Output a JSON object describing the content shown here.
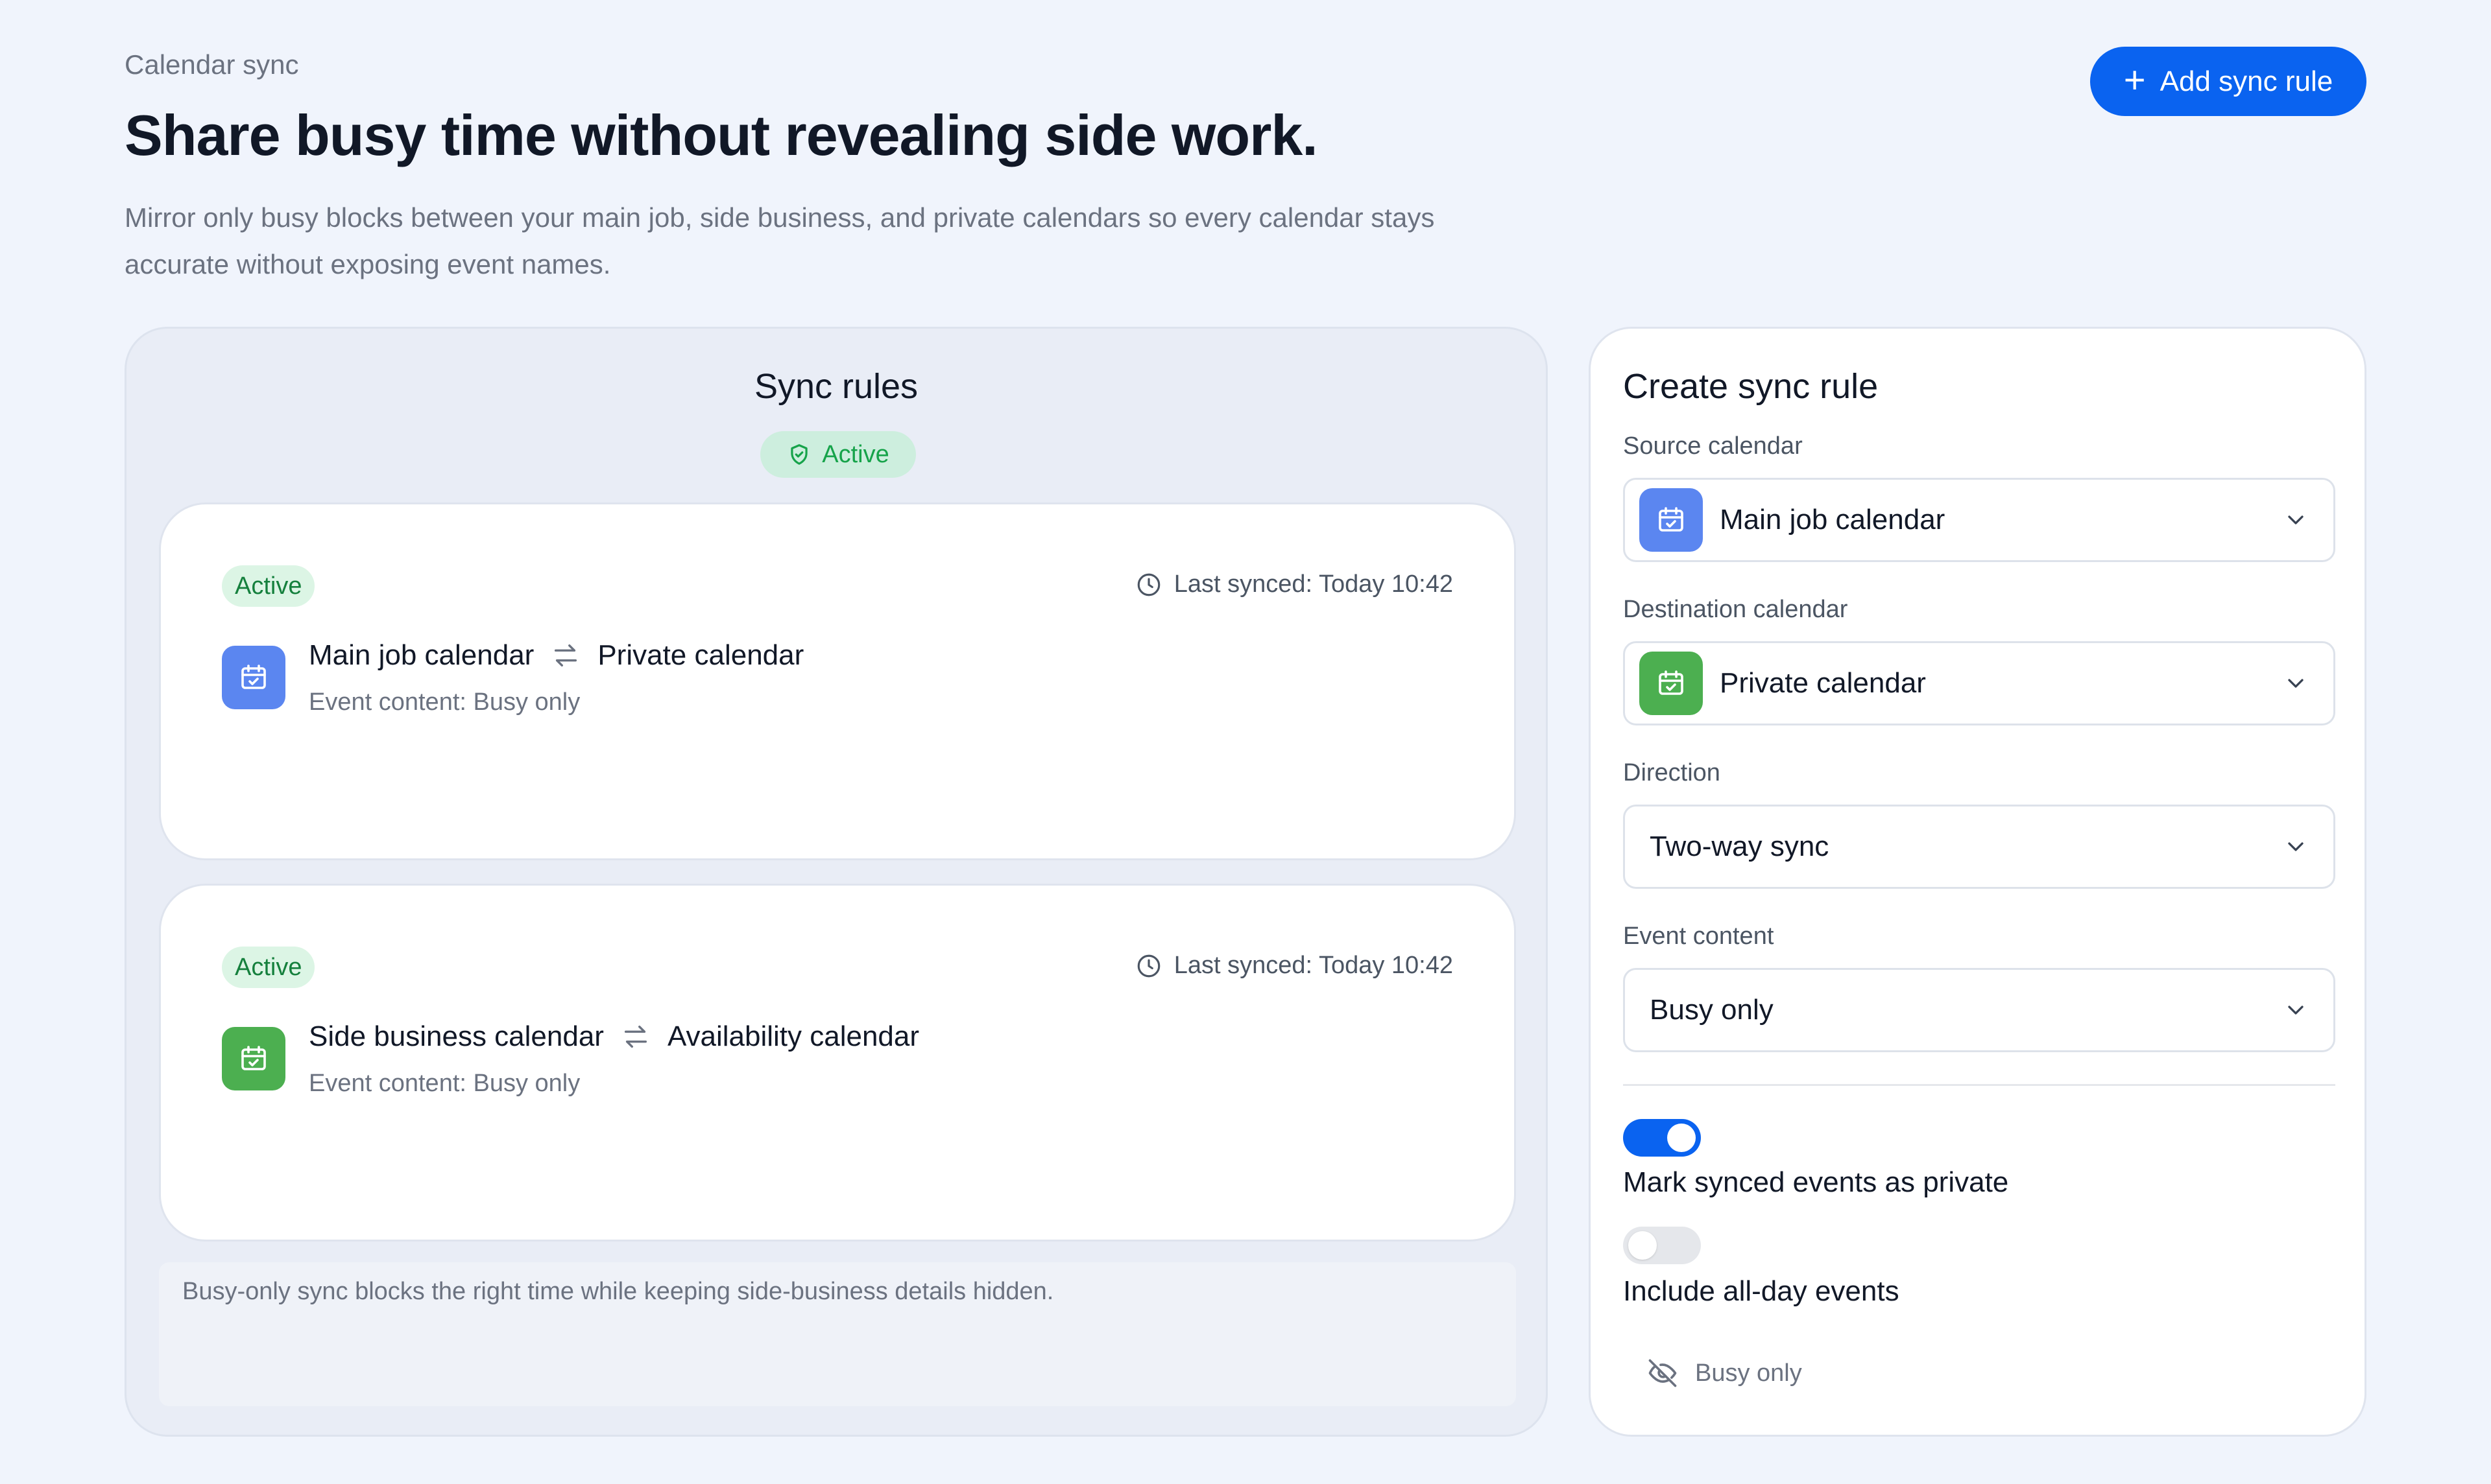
{
  "header": {
    "eyebrow": "Calendar sync",
    "title": "Share busy time without revealing side work.",
    "description": "Mirror only busy blocks between your main job, side business, and private calendars so every calendar stays accurate without exposing event names.",
    "add_button_label": "Add sync rule"
  },
  "rules_panel": {
    "title": "Sync rules",
    "status_badge": "Active",
    "rules": [
      {
        "status": "Active",
        "last_synced": "Last synced: Today 10:42",
        "source": "Main job calendar",
        "destination": "Private calendar",
        "content": "Event content: Busy only",
        "icon_color": "#5b86f0"
      },
      {
        "status": "Active",
        "last_synced": "Last synced: Today 10:42",
        "source": "Side business calendar",
        "destination": "Availability calendar",
        "content": "Event content: Busy only",
        "icon_color": "#4caf50"
      }
    ],
    "note": "Busy-only sync blocks the right time while keeping side-business details hidden."
  },
  "form": {
    "title": "Create sync rule",
    "source_label": "Source calendar",
    "source_value": "Main job calendar",
    "destination_label": "Destination calendar",
    "destination_value": "Private calendar",
    "direction_label": "Direction",
    "direction_value": "Two-way sync",
    "content_label": "Event content",
    "content_value": "Busy only",
    "toggle_private_label": "Mark synced events as private",
    "toggle_private_on": true,
    "toggle_allday_label": "Include all-day events",
    "toggle_allday_on": false,
    "footer_note": "Busy only"
  },
  "colors": {
    "accent": "#0a63f0",
    "success": "#16a34a",
    "background": "#f0f4fc"
  },
  "icons": [
    "plus-icon",
    "shield-check-icon",
    "clock-icon",
    "calendar-check-icon",
    "swap-arrows-icon",
    "chevron-down-icon",
    "eye-off-icon"
  ]
}
